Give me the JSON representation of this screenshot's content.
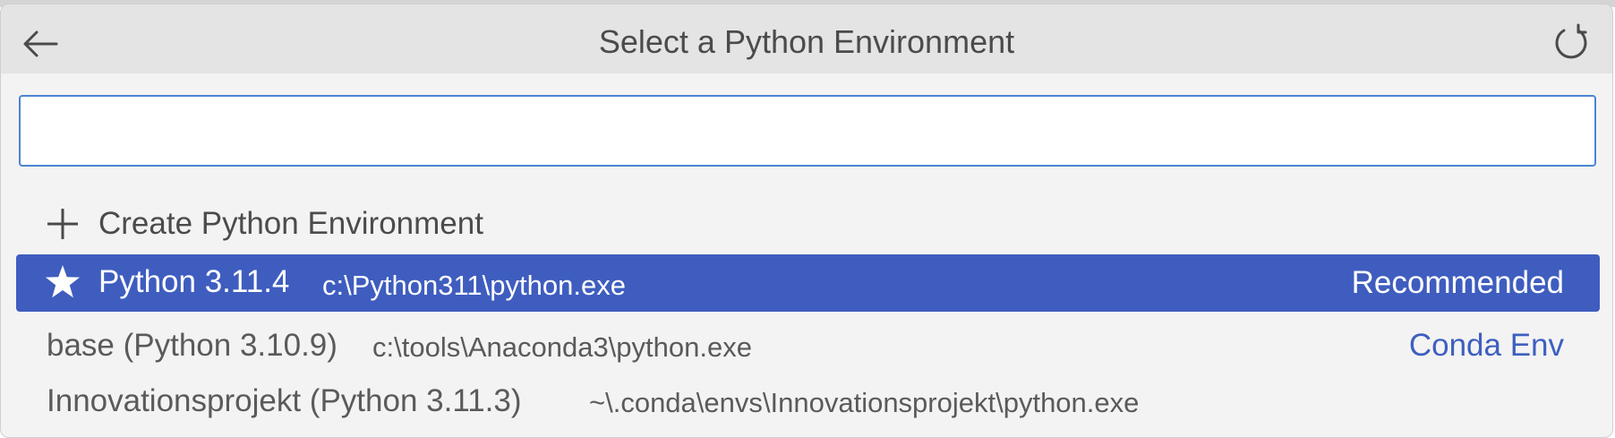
{
  "header": {
    "title": "Select a Python Environment",
    "back_icon": "arrow-left-icon",
    "refresh_icon": "refresh-icon"
  },
  "search": {
    "value": "",
    "placeholder": ""
  },
  "items": [
    {
      "icon": "plus-icon",
      "label": "Create Python Environment"
    },
    {
      "icon": "star-icon",
      "label": "Python 3.11.4",
      "path": "c:\\Python311\\python.exe",
      "badge": "Recommended",
      "selected": true
    },
    {
      "label": "base (Python 3.10.9)",
      "path": "c:\\tools\\Anaconda3\\python.exe",
      "badge": "Conda Env"
    },
    {
      "label": "Innovationsprojekt (Python 3.11.3)",
      "path": "~\\.conda\\envs\\Innovationsprojekt\\python.exe"
    }
  ],
  "colors": {
    "selection": "#3f5dbf",
    "accent": "#3e5fc0",
    "focus_border": "#4c84d3"
  }
}
